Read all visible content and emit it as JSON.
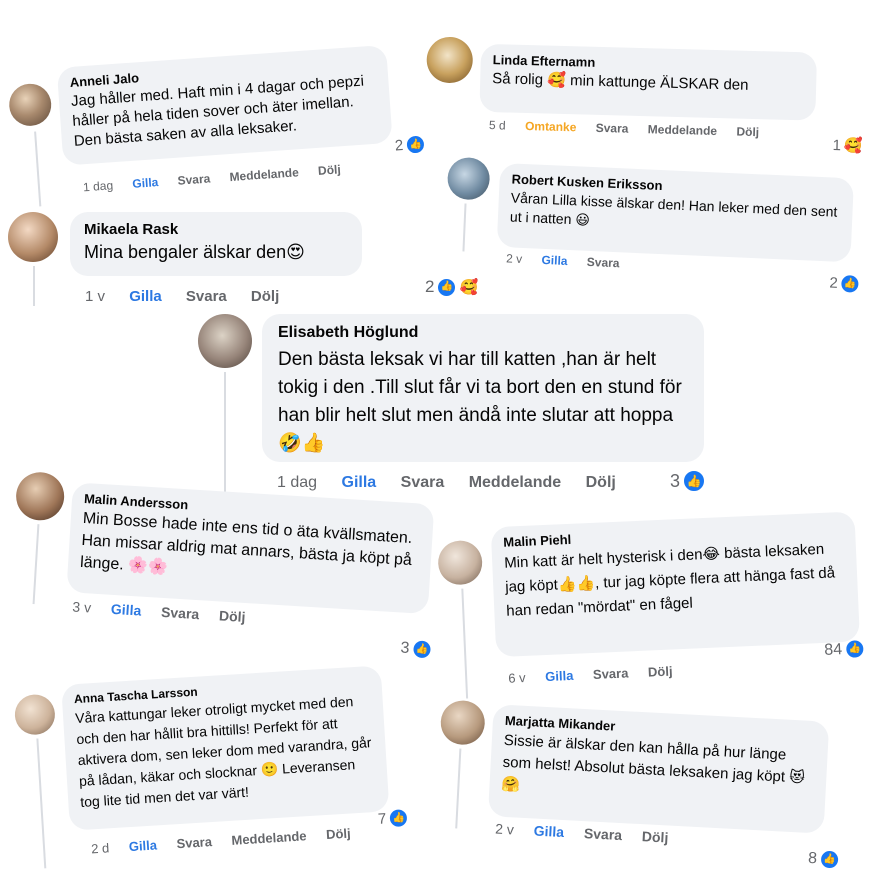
{
  "comments": [
    {
      "name": "Anneli Jalo",
      "text": "Jag håller med. Haft min i 4 dagar och pepzi håller på hela tiden sover och äter imellan. Den bästa saken av alla leksaker.",
      "time": "1 dag",
      "like": "Gilla",
      "reply": "Svara",
      "message": "Meddelande",
      "hide": "Dölj",
      "count": "2"
    },
    {
      "name": "Linda Efternamn",
      "text": "Så rolig 🥰 min kattunge ÄLSKAR den",
      "time": "5 d",
      "like": "Omtanke",
      "reply": "Svara",
      "message": "Meddelande",
      "hide": "Dölj",
      "count": "1"
    },
    {
      "name": "Robert Kusken Eriksson",
      "text": "Våran Lilla kisse älskar den! Han leker med den sent ut i natten 😃",
      "time": "2 v",
      "like": "Gilla",
      "reply": "Svara",
      "count": "2"
    },
    {
      "name": "Mikaela Rask",
      "text": "Mina bengaler älskar den😍",
      "time": "1 v",
      "like": "Gilla",
      "reply": "Svara",
      "hide": "Dölj",
      "count": "2"
    },
    {
      "name": "Elisabeth Höglund",
      "text": "Den bästa leksak vi har  till katten ,han är helt tokig i den .Till slut får vi ta bort  den en stund  för han blir  helt slut  men ändå inte slutar att  hoppa 🤣👍",
      "time": "1 dag",
      "like": "Gilla",
      "reply": "Svara",
      "message": "Meddelande",
      "hide": "Dölj",
      "count": "3"
    },
    {
      "name": "Malin Andersson",
      "text": "Min Bosse hade inte ens tid o äta kvällsmaten. Han missar aldrig mat annars, bästa ja köpt på länge. 🌸🌸",
      "time": "3 v",
      "like": "Gilla",
      "reply": "Svara",
      "hide": "Dölj",
      "count": "3"
    },
    {
      "name": "Malin Piehl",
      "text": "Min katt är helt hysterisk i den😂 bästa leksaken jag köpt👍👍, tur jag köpte flera att hänga fast då han redan \"mördat\" en fågel",
      "time": "6 v",
      "like": "Gilla",
      "reply": "Svara",
      "hide": "Dölj",
      "count": "84"
    },
    {
      "name": "Anna Tascha Larsson",
      "text": "Våra kattungar leker otroligt mycket med den och den har hållit bra hittills! Perfekt för att aktivera dom, sen leker dom med varandra, går på lådan, käkar och slocknar 🙂 Leveransen tog lite tid men det var värt!",
      "time": "2 d",
      "like": "Gilla",
      "reply": "Svara",
      "message": "Meddelande",
      "hide": "Dölj",
      "count": "7"
    },
    {
      "name": "Marjatta Mikander",
      "text": "Sissie är älskar den kan hålla på hur länge som helst! Absolut bästa leksaken jag köpt 😻🤗",
      "time": "2 v",
      "like": "Gilla",
      "reply": "Svara",
      "hide": "Dölj",
      "count": "8"
    }
  ],
  "icons": {
    "like_badge": "thumbs-up-icon",
    "care_badge": "care-emoji-icon",
    "heart_badge": "care-emoji-icon"
  },
  "colors": {
    "bubble": "#f0f2f5",
    "like_blue": "#1877f2",
    "link_blue": "#2d79e2",
    "care_orange": "#f5a623",
    "muted": "#65676b"
  }
}
